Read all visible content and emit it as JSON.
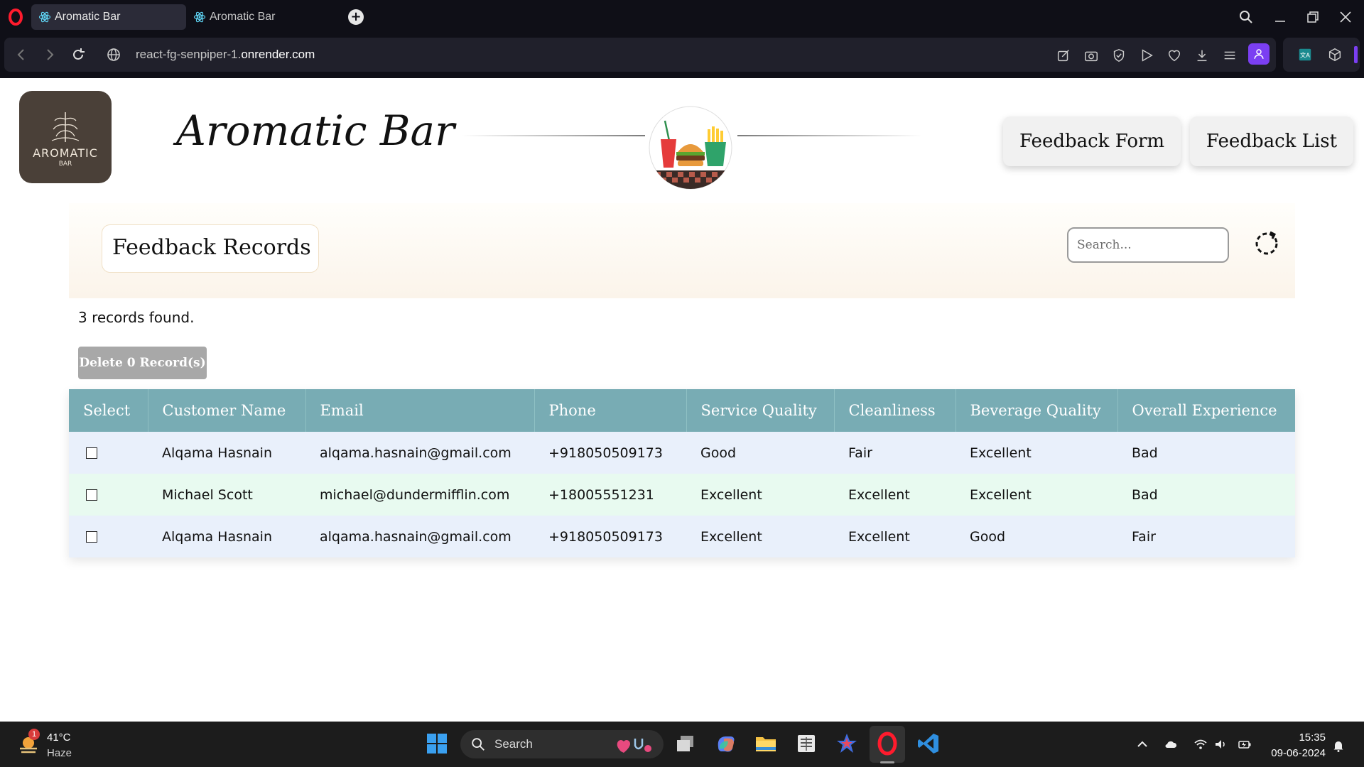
{
  "browser": {
    "tabs": [
      {
        "label": "Aromatic Bar",
        "active": true
      },
      {
        "label": "Aromatic Bar",
        "active": false
      }
    ],
    "new_tab_label": "+",
    "url_prefix": "react-fg-senpiper-1.",
    "url_host": "onrender.com"
  },
  "header": {
    "logo_text": "AROMATIC",
    "logo_subtext": "BAR",
    "brand_title": "Aromatic Bar",
    "nav_buttons": [
      "Feedback Form",
      "Feedback List"
    ]
  },
  "records": {
    "title": "Feedback Records",
    "search_placeholder": "Search...",
    "count_text": "3 records found.",
    "delete_label": "Delete 0 Record(s)"
  },
  "table": {
    "columns": [
      "Select",
      "Customer Name",
      "Email",
      "Phone",
      "Service Quality",
      "Cleanliness",
      "Beverage Quality",
      "Overall Experience"
    ],
    "rows": [
      {
        "name": "Alqama Hasnain",
        "email": "alqama.hasnain@gmail.com",
        "phone": "+918050509173",
        "service": "Good",
        "cleanliness": "Fair",
        "beverage": "Excellent",
        "overall": "Bad",
        "checked": false
      },
      {
        "name": "Michael Scott",
        "email": "michael@dundermifflin.com",
        "phone": "+18005551231",
        "service": "Excellent",
        "cleanliness": "Excellent",
        "beverage": "Excellent",
        "overall": "Bad",
        "checked": false
      },
      {
        "name": "Alqama Hasnain",
        "email": "alqama.hasnain@gmail.com",
        "phone": "+918050509173",
        "service": "Excellent",
        "cleanliness": "Excellent",
        "beverage": "Good",
        "overall": "Fair",
        "checked": false
      }
    ]
  },
  "taskbar": {
    "weather_badge": "1",
    "weather_temp": "41°C",
    "weather_desc": "Haze",
    "search_label": "Search",
    "time": "15:35",
    "date": "09-06-2024"
  },
  "colors": {
    "table_header": "#78acb4",
    "row_alt_a": "#e9f0fb",
    "row_alt_b": "#e8faf0",
    "delete_button": "#a8a8a8",
    "browser_accent": "#7b3ff2"
  }
}
